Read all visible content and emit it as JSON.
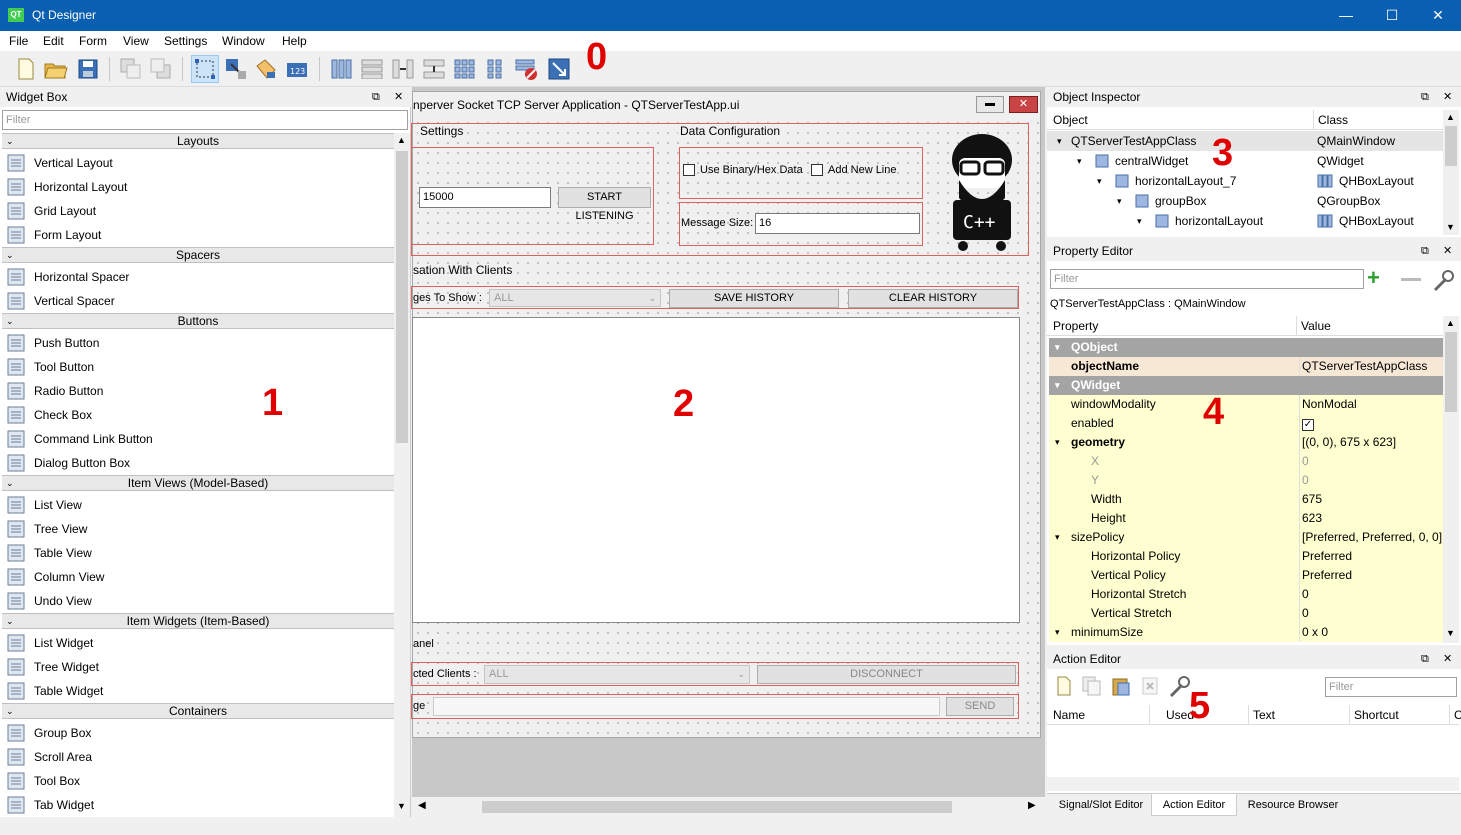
{
  "window": {
    "title": "Qt Designer",
    "app_icon": "QT",
    "minimize": "—",
    "maximize": "☐",
    "close": "✕"
  },
  "menu": [
    "File",
    "Edit",
    "Form",
    "View",
    "Settings",
    "Window",
    "Help"
  ],
  "annotations": {
    "a0": "0",
    "a1": "1",
    "a2": "2",
    "a3": "3",
    "a4": "4",
    "a5": "5"
  },
  "widget_box": {
    "title": "Widget Box",
    "filter_placeholder": "Filter",
    "categories": [
      {
        "name": "Layouts",
        "items": [
          "Vertical Layout",
          "Horizontal Layout",
          "Grid Layout",
          "Form Layout"
        ]
      },
      {
        "name": "Spacers",
        "items": [
          "Horizontal Spacer",
          "Vertical Spacer"
        ]
      },
      {
        "name": "Buttons",
        "items": [
          "Push Button",
          "Tool Button",
          "Radio Button",
          "Check Box",
          "Command Link Button",
          "Dialog Button Box"
        ]
      },
      {
        "name": "Item Views (Model-Based)",
        "items": [
          "List View",
          "Tree View",
          "Table View",
          "Column View",
          "Undo View"
        ]
      },
      {
        "name": "Item Widgets (Item-Based)",
        "items": [
          "List Widget",
          "Tree Widget",
          "Table Widget"
        ]
      },
      {
        "name": "Containers",
        "items": [
          "Group Box",
          "Scroll Area",
          "Tool Box",
          "Tab Widget"
        ]
      }
    ]
  },
  "form": {
    "title": "nperver Socket TCP Server Application - QTServerTestApp.ui",
    "settings_group": "Settings",
    "port_value": "15000",
    "start_listening": "START LISTENING",
    "data_config_group": "Data Configuration",
    "use_binary": "Use Binary/Hex Data",
    "add_new_line": "Add New Line",
    "message_size_label": "Message Size:",
    "message_size_value": "16",
    "logo_text": "C++",
    "conversation_group": "sation With Clients",
    "messages_to_show_label": "ges To Show :",
    "messages_to_show_value": "ALL",
    "save_history": "SAVE HISTORY",
    "clear_history": "CLEAR HISTORY",
    "panel_group": "anel",
    "connected_clients_label": "cted Clients :",
    "connected_clients_value": "ALL",
    "disconnect": "DISCONNECT",
    "message_label": "ge",
    "send": "SEND"
  },
  "object_inspector": {
    "title": "Object Inspector",
    "col_object": "Object",
    "col_class": "Class",
    "rows": [
      {
        "name": "QTServerTestAppClass",
        "cls": "QMainWindow"
      },
      {
        "name": "centralWidget",
        "cls": "QWidget"
      },
      {
        "name": "horizontalLayout_7",
        "cls": "QHBoxLayout"
      },
      {
        "name": "groupBox",
        "cls": "QGroupBox"
      },
      {
        "name": "horizontalLayout",
        "cls": "QHBoxLayout"
      }
    ]
  },
  "property_editor": {
    "title": "Property Editor",
    "filter_placeholder": "Filter",
    "context": "QTServerTestAppClass : QMainWindow",
    "col_property": "Property",
    "col_value": "Value",
    "rows": [
      {
        "name": "QObject",
        "value": ""
      },
      {
        "name": "objectName",
        "value": "QTServerTestAppClass"
      },
      {
        "name": "QWidget",
        "value": ""
      },
      {
        "name": "windowModality",
        "value": "NonModal"
      },
      {
        "name": "enabled",
        "value": "✓"
      },
      {
        "name": "geometry",
        "value": "[(0, 0), 675 x 623]"
      },
      {
        "name": "X",
        "value": "0"
      },
      {
        "name": "Y",
        "value": "0"
      },
      {
        "name": "Width",
        "value": "675"
      },
      {
        "name": "Height",
        "value": "623"
      },
      {
        "name": "sizePolicy",
        "value": "[Preferred, Preferred, 0, 0]"
      },
      {
        "name": "Horizontal Policy",
        "value": "Preferred"
      },
      {
        "name": "Vertical Policy",
        "value": "Preferred"
      },
      {
        "name": "Horizontal Stretch",
        "value": "0"
      },
      {
        "name": "Vertical Stretch",
        "value": "0"
      },
      {
        "name": "minimumSize",
        "value": "0 x 0"
      }
    ]
  },
  "action_editor": {
    "title": "Action Editor",
    "filter_placeholder": "Filter",
    "columns": [
      "Name",
      "Used",
      "Text",
      "Shortcut",
      "C"
    ]
  },
  "bottom_tabs": [
    "Signal/Slot Editor",
    "Action Editor",
    "Resource Browser"
  ],
  "colors": {
    "titlebar": "#0a5fb0",
    "annotation": "#e00000",
    "group_row": "#a4a4a4",
    "yellow_row": "#fefed0"
  }
}
